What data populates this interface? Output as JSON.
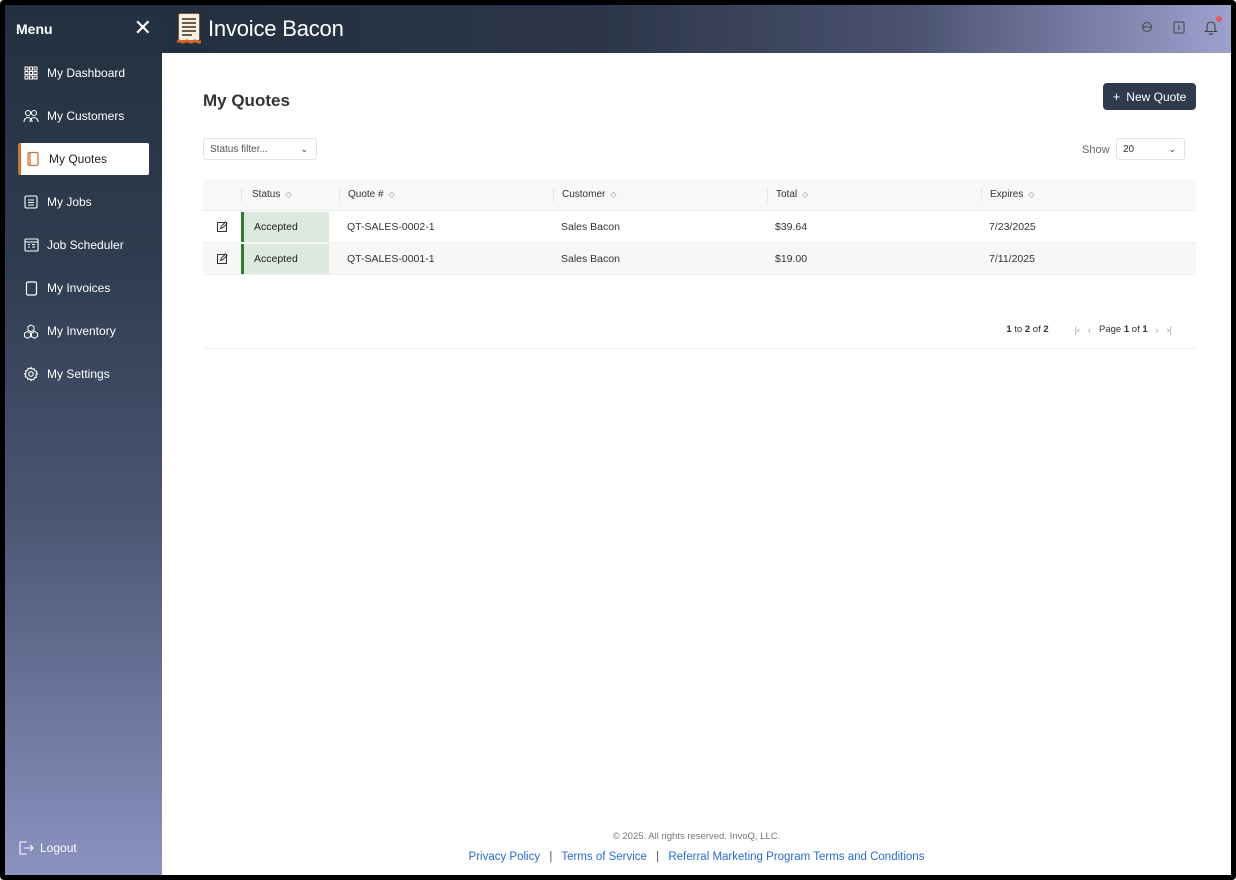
{
  "sidebar": {
    "title": "Menu",
    "items": [
      {
        "label": "My Dashboard",
        "icon": "dashboard-grid-icon"
      },
      {
        "label": "My Customers",
        "icon": "people-icon"
      },
      {
        "label": "My Quotes",
        "icon": "document-icon",
        "active": true
      },
      {
        "label": "My Jobs",
        "icon": "list-box-icon"
      },
      {
        "label": "Job Scheduler",
        "icon": "calendar-icon"
      },
      {
        "label": "My Invoices",
        "icon": "invoice-icon"
      },
      {
        "label": "My Inventory",
        "icon": "boxes-icon"
      },
      {
        "label": "My Settings",
        "icon": "gear-icon"
      }
    ],
    "logout_label": "Logout"
  },
  "header": {
    "brand": "Invoice Bacon"
  },
  "main": {
    "title": "My Quotes",
    "new_quote_label": "New Quote",
    "status_filter_placeholder": "Status filter...",
    "show_label": "Show",
    "show_value": "20",
    "columns": [
      "Status",
      "Quote #",
      "Customer",
      "Total",
      "Expires"
    ],
    "rows": [
      {
        "status": "Accepted",
        "quote": "QT-SALES-0002-1",
        "customer": "Sales Bacon",
        "total": "$39.64",
        "expires": "7/23/2025"
      },
      {
        "status": "Accepted",
        "quote": "QT-SALES-0001-1",
        "customer": "Sales Bacon",
        "total": "$19.00",
        "expires": "7/11/2025"
      }
    ],
    "pager": {
      "from": "1",
      "to_text": "to",
      "to": "2",
      "of_text": "of",
      "total": "2",
      "page_text": "Page",
      "page": "1",
      "page_of_text": "of",
      "pages": "1"
    }
  },
  "footer": {
    "copyright": "© 2025. All rights reserved. InvoQ, LLC.",
    "privacy": "Privacy Policy",
    "terms": "Terms of Service",
    "referral": "Referral Marketing Program Terms and Conditions"
  },
  "colors": {
    "accent_dark": "#2f3b4c",
    "status_accepted": "#2e7d32",
    "link": "#2a6ad6"
  }
}
